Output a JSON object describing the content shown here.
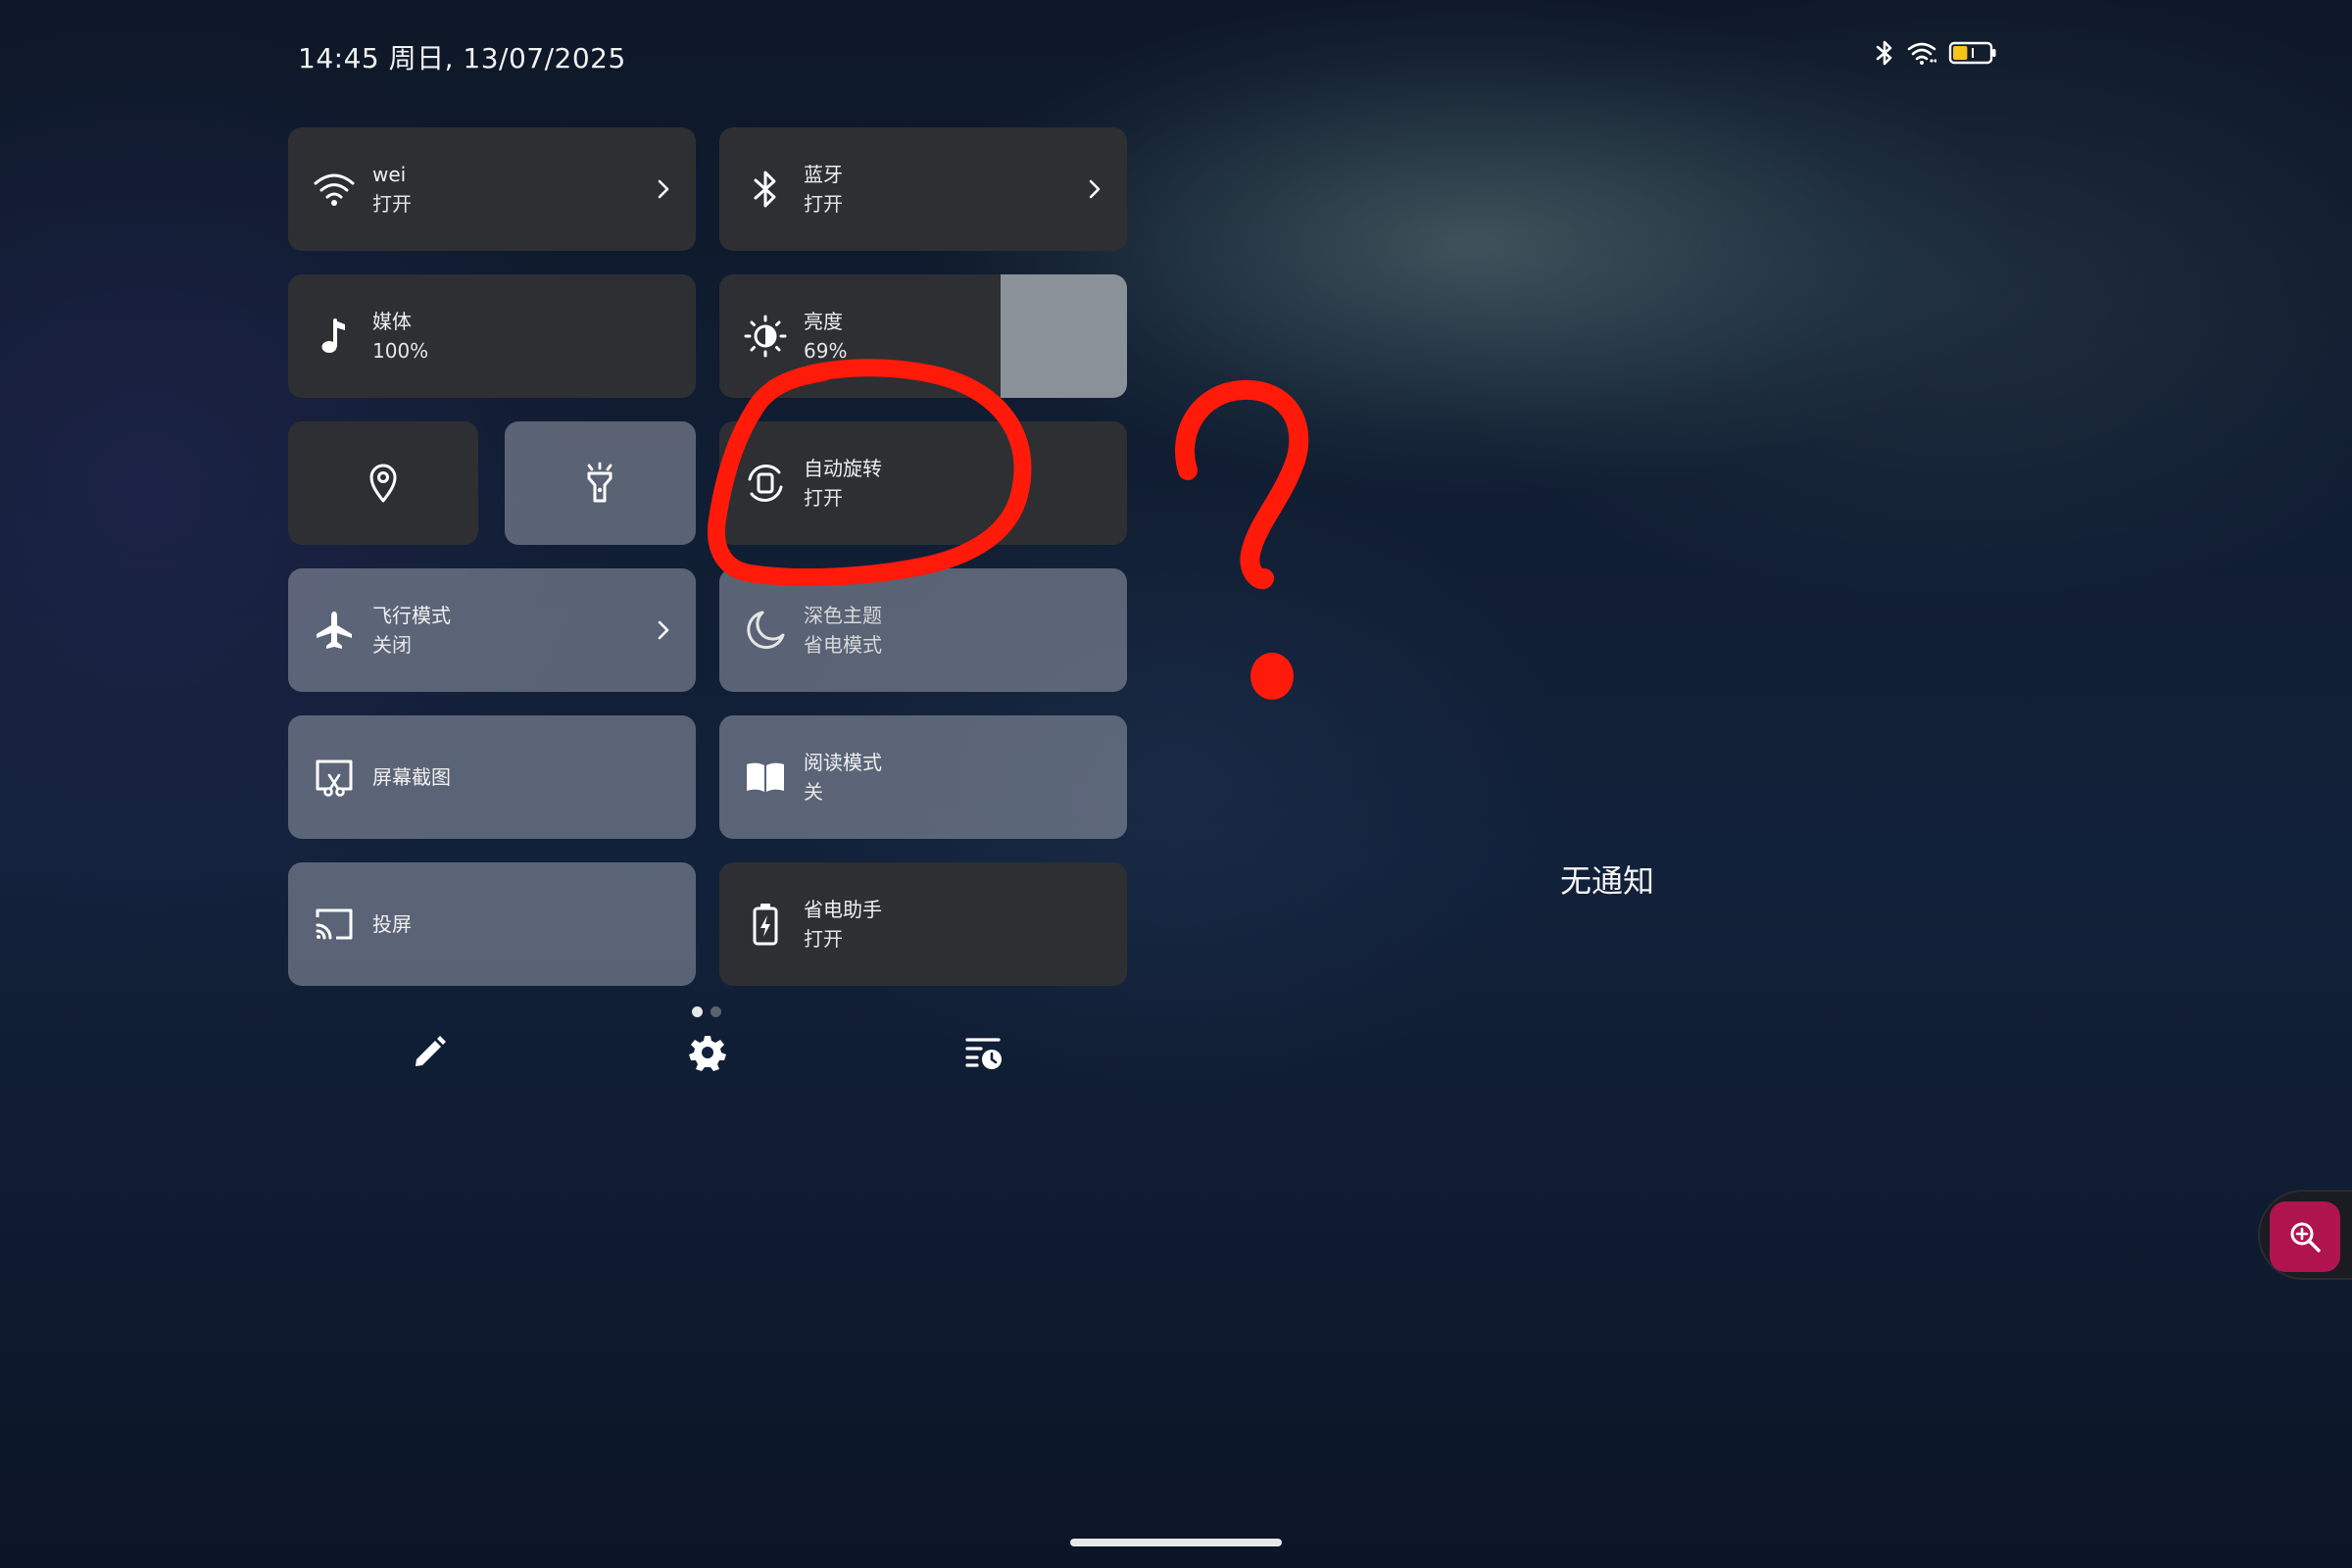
{
  "status_bar": {
    "datetime": "14:45 周日, 13/07/2025",
    "icons": [
      "bluetooth-icon",
      "wifi-icon",
      "battery-icon"
    ],
    "battery_level": 0.4
  },
  "tiles": {
    "wifi": {
      "title": "wei",
      "state": "打开",
      "icon": "wifi-icon",
      "active": false
    },
    "bluetooth": {
      "title": "蓝牙",
      "state": "打开",
      "icon": "bluetooth-icon",
      "active": false
    },
    "media": {
      "title": "媒体",
      "value": "100%",
      "icon": "music-note-icon",
      "active": false
    },
    "brightness": {
      "title": "亮度",
      "value": "69%",
      "level": 0.69,
      "icon": "brightness-icon"
    },
    "location": {
      "icon": "location-pin-icon",
      "active": false
    },
    "flashlight": {
      "icon": "flashlight-icon",
      "active": true
    },
    "auto_rotate": {
      "title": "自动旋转",
      "state": "打开",
      "icon": "auto-rotate-icon",
      "active": false
    },
    "airplane": {
      "title": "飞行模式",
      "state": "关闭",
      "icon": "airplane-icon",
      "active": true
    },
    "dark_theme": {
      "title": "深色主题",
      "state": "省电模式",
      "icon": "moon-icon",
      "active": true
    },
    "screenshot": {
      "title": "屏幕截图",
      "icon": "screenshot-icon",
      "active": true
    },
    "reading": {
      "title": "阅读模式",
      "state": "关",
      "icon": "book-icon",
      "active": true
    },
    "cast": {
      "title": "投屏",
      "icon": "cast-icon",
      "active": true
    },
    "battery_saver": {
      "title": "省电助手",
      "state": "打开",
      "icon": "battery-saver-icon",
      "active": false
    }
  },
  "pager": {
    "pages": 2,
    "current": 1
  },
  "bottom_actions": [
    "edit-pencil-icon",
    "settings-gear-icon",
    "notification-history-icon"
  ],
  "notifications": {
    "empty_text": "无通知"
  },
  "annotation": {
    "color": "#ff1a0a",
    "marks": [
      "circle-around-auto-rotate",
      "question-mark"
    ]
  },
  "floating_button": {
    "icon": "zoom-in-icon",
    "color": "#b0144f"
  }
}
